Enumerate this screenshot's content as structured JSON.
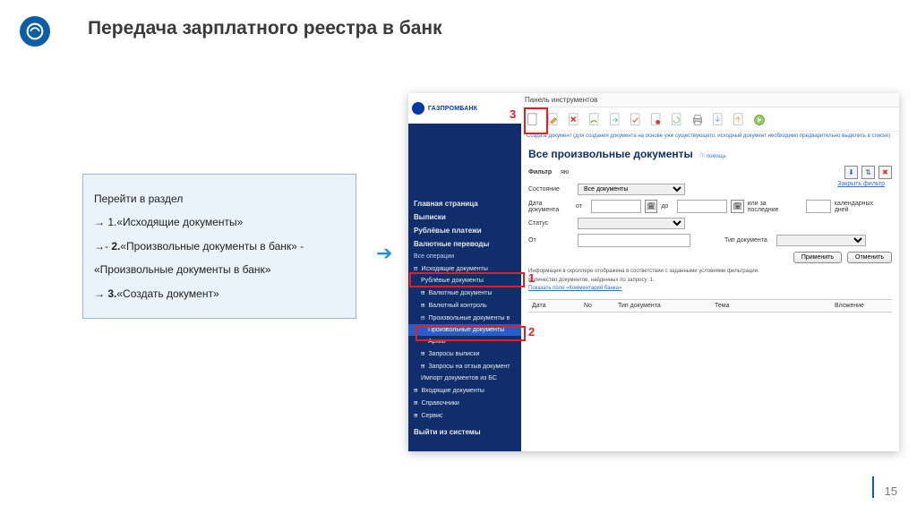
{
  "slide": {
    "title": "Передача зарплатного реестра в банк",
    "page_number": "15"
  },
  "instructions": {
    "intro": "Перейти в раздел",
    "step1_num": "1.",
    "step1_text": "«Исходящие документы»",
    "step2_prefix": "- ",
    "step2_num": "2.",
    "step2_text": "«Произвольные   документы в банк»",
    "step2_tail": " -",
    "step2_sub": "«Произвольные документы в банк»",
    "step3_num": "3.",
    "step3_text": "«Создать документ»"
  },
  "app": {
    "bank_name": "ГАЗПРОМБАНК",
    "panel_title": "Панель инструментов",
    "toolbar_hint": "Создать документ (для создания документа на основе уже существующего, исходный документ необходимо предварительно выделить в списке)",
    "header": "Все произвольные документы",
    "help_text": "Ⓘ помощь",
    "filter_label": "Фильтр",
    "filter_name": "яю",
    "close_filter": "Закрыть фильтр",
    "state_label": "Состояние",
    "state_value": "Все документы",
    "date_label": "Дата документа",
    "date_from": "от",
    "date_to": "до",
    "date_alt": "или за последние",
    "date_days_suffix": "календарных дней",
    "status_label": "Статус",
    "from_label": "От",
    "doctype_label": "Тип документа",
    "apply": "Применить",
    "cancel": "Отменить",
    "info1": "Информация в скроллере отображена в соответствии с заданными условиями фильтрации.",
    "info2_a": "Количество документов, найденных по запросу: ",
    "info2_count": "1.",
    "info3": "Показать поле «Комментарий банка»",
    "cols": {
      "date": "Дата",
      "no": "No",
      "type": "Тип документа",
      "subject": "Тема",
      "attach": "Вложение"
    },
    "menu": {
      "home": "Главная страница",
      "statements": "Выписки",
      "rub": "Рублёвые платежи",
      "fx": "Валютные переводы",
      "all_ops": "Все операции",
      "outgoing": "Исходящие документы",
      "rub_docs": "Рублёвые документы",
      "fx_docs": "Валютные документы",
      "fx_ctrl": "Валютный контроль",
      "arb_bank": "Произвольные документы в",
      "arb_docs": "Произвольные документы",
      "archive": "Архив",
      "req_stmt": "Запросы выписки",
      "req_recall": "Запросы на отзыв документ",
      "import": "Импорт документов из БС",
      "incoming": "Входящие документы",
      "refs": "Справочники",
      "service": "Сервис",
      "logout": "Выйти из системы"
    }
  },
  "callouts": {
    "n1": "1",
    "n2": "2",
    "n3": "3"
  }
}
